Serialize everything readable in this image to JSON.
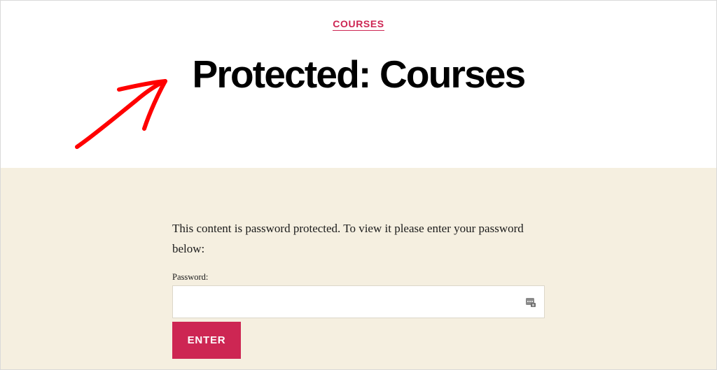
{
  "header": {
    "category_label": "COURSES",
    "title": "Protected: Courses"
  },
  "annotation": {
    "type": "arrow",
    "color": "#ff0000"
  },
  "content": {
    "message": "This content is password protected. To view it please enter your password below:",
    "password_label": "Password:",
    "password_value": "",
    "submit_label": "ENTER"
  },
  "colors": {
    "accent": "#cd2653",
    "content_background": "#f5efe0",
    "header_background": "#ffffff",
    "title_text": "#000000"
  },
  "icons": {
    "password_field_icon": "password-manager-key-icon"
  }
}
